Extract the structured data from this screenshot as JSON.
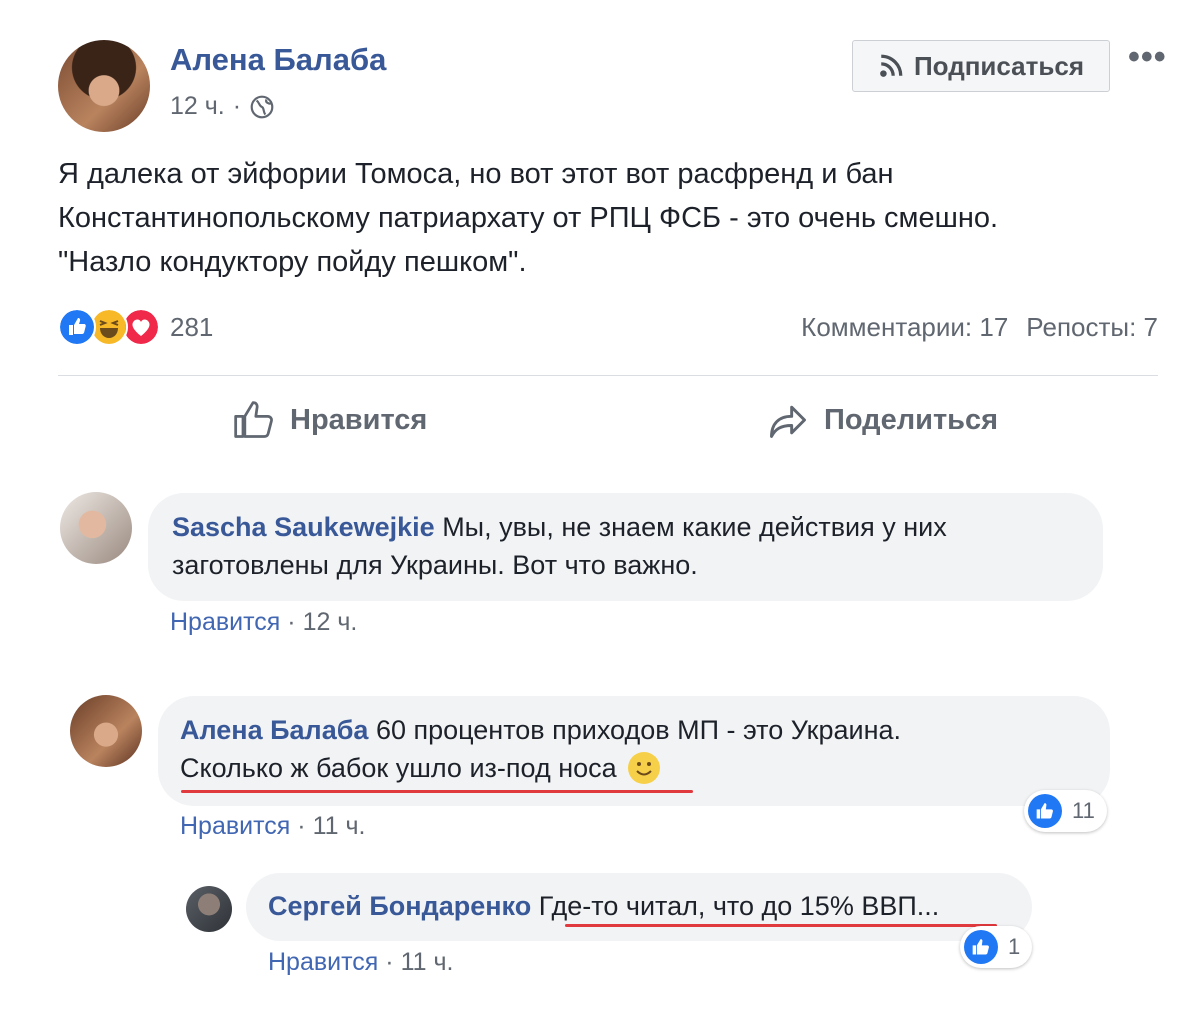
{
  "post": {
    "author": "Алена Балаба",
    "time": "12 ч.",
    "separator": "·",
    "follow_label": "Подписаться",
    "more_label": "•••",
    "text_lines": [
      "Я далека от эйфории Томоса, но вот этот вот расфренд и бан",
      "Константинопольскому патриархату от РПЦ ФСБ - это очень смешно.",
      "\"Назло кондуктору пойду пешком\"."
    ],
    "reaction_count": "281",
    "comments_count": "Комментарии: 17",
    "shares_count": "Репосты: 7",
    "like_action": "Нравится",
    "share_action": "Поделиться"
  },
  "comments": [
    {
      "author": "Sascha Saukewejkie",
      "line1": "Мы, увы, не знаем какие действия у них",
      "line2": "заготовлены для Украины. Вот что важно.",
      "like": "Нравится",
      "time": "12 ч."
    },
    {
      "author": "Алена Балаба",
      "line1": "60 процентов приходов МП - это Украина.",
      "line2": "Сколько ж бабок ушло из-под носа",
      "like": "Нравится",
      "time": "11 ч.",
      "likes": "11"
    },
    {
      "author": "Сергей Бондаренко",
      "line1": "Где-то читал, что до 15% ВВП...",
      "like": "Нравится",
      "time": "11 ч.",
      "likes": "1"
    }
  ],
  "colors": {
    "link": "#385898",
    "like_blue": "#2078f4",
    "underline": "#e03a3e"
  }
}
